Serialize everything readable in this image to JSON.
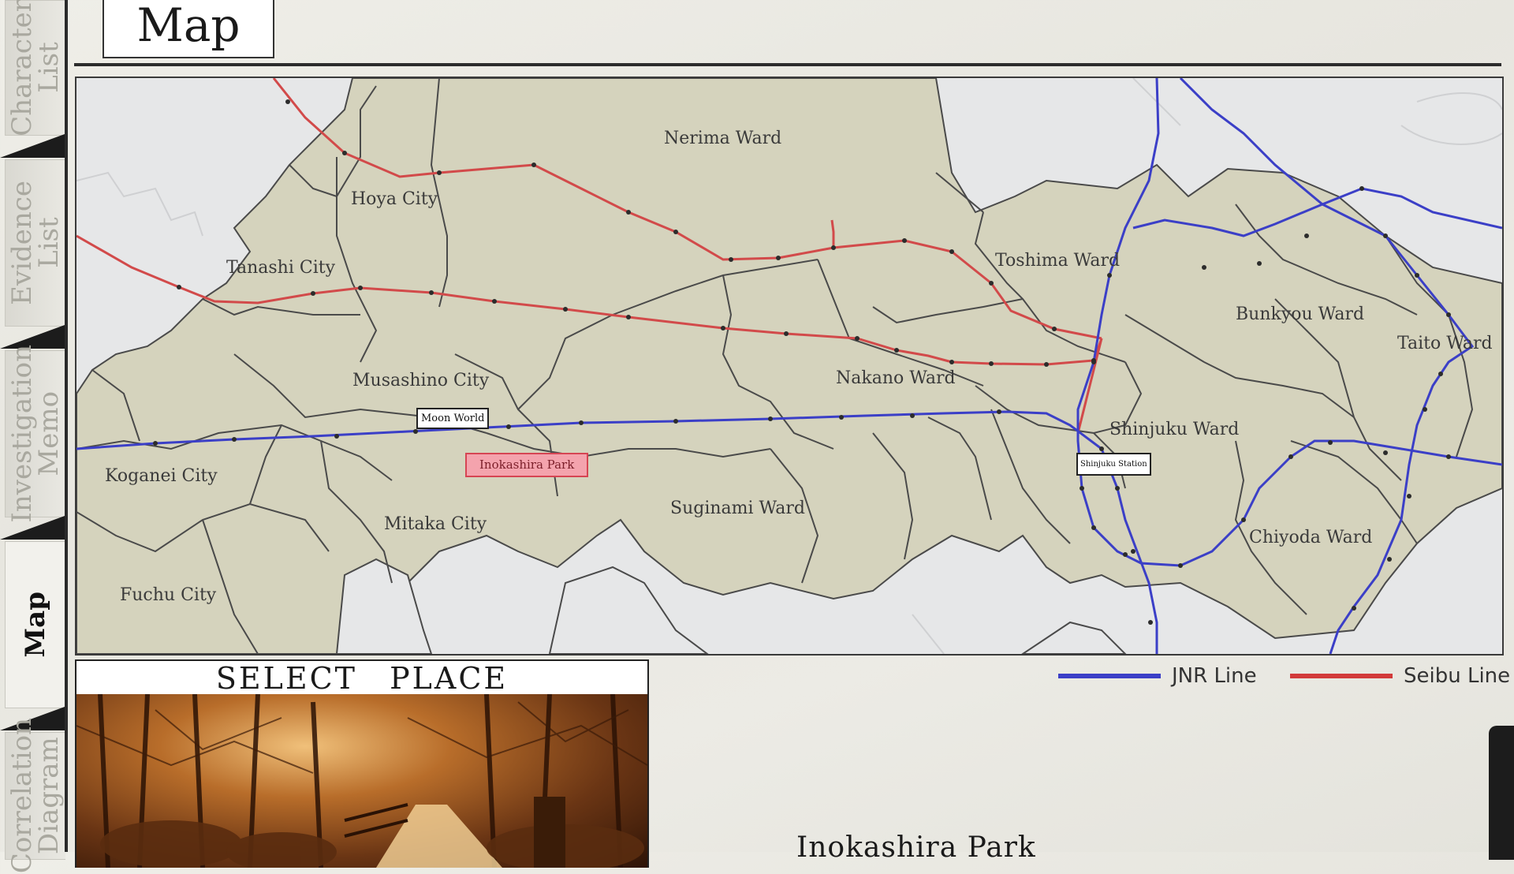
{
  "tabs": [
    {
      "label": "Character\nList",
      "active": false
    },
    {
      "label": "Evidence\nList",
      "active": false
    },
    {
      "label": "Investigation\nMemo",
      "active": false
    },
    {
      "label": "Map",
      "active": true
    },
    {
      "label": "Correlation\nDiagram",
      "active": false
    }
  ],
  "header": {
    "title": "Map"
  },
  "map": {
    "regions": [
      "Nerima Ward",
      "Hoya City",
      "Tanashi City",
      "Toshima Ward",
      "Bunkyou Ward",
      "Taito Ward",
      "Musashino City",
      "Nakano Ward",
      "Shinjuku Ward",
      "Koganei City",
      "Mitaka City",
      "Suginami Ward",
      "Chiyoda Ward",
      "Fuchu City"
    ],
    "places": {
      "moon_world": "Moon World",
      "inokashira_park": "Inokashira Park",
      "shinjuku_station": "Shinjuku Station"
    },
    "selected_place": "Inokashira Park"
  },
  "legend": {
    "jnr": {
      "label": "JNR Line",
      "color": "#3b3fc7"
    },
    "seibu": {
      "label": "Seibu Line",
      "color": "#d23a3a"
    }
  },
  "select_panel": {
    "title": "SELECT PLACE",
    "place_name": "Inokashira Park"
  },
  "colors": {
    "land": "#d5d3bd",
    "water": "#e6e7e8",
    "border": "#4a4a4a"
  }
}
